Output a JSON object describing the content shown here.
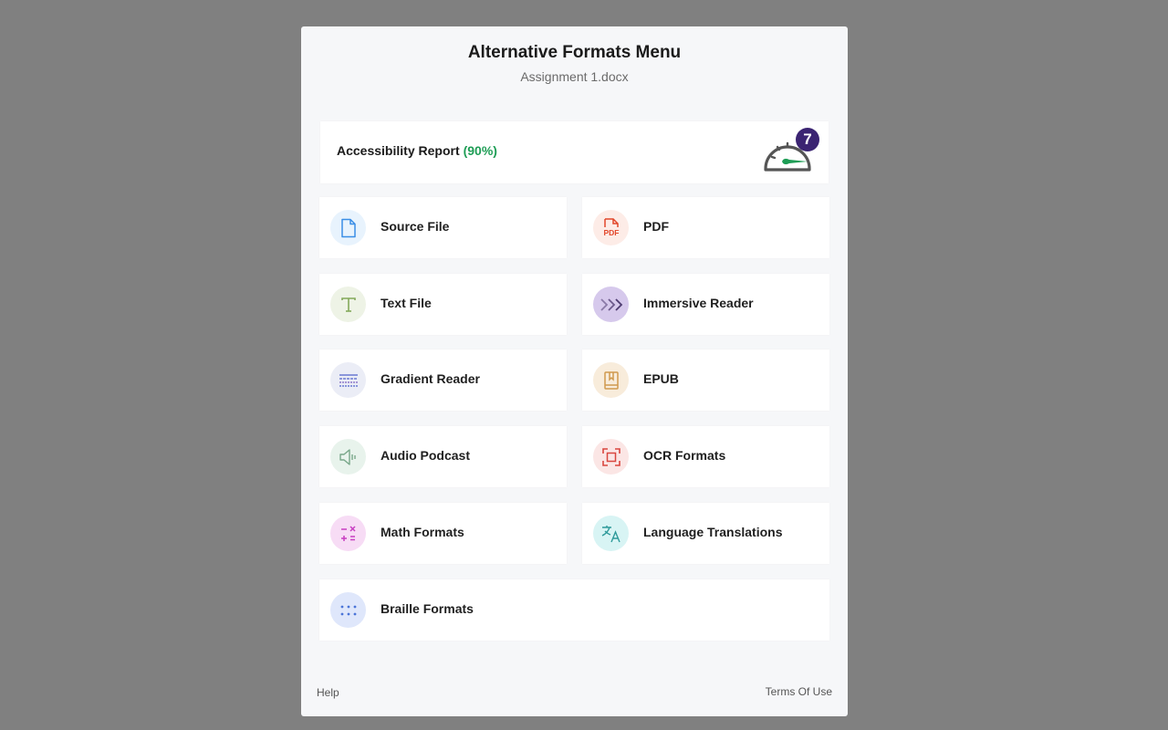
{
  "dialog": {
    "title": "Alternative Formats Menu",
    "subtitle": "Assignment 1.docx"
  },
  "report": {
    "label": "Accessibility Report",
    "percent": "(90%)",
    "badge_count": "7",
    "score_fraction": 0.9,
    "colors": {
      "percent": "#1e9d55",
      "badge": "#3b2472",
      "needle": "#1e9d55"
    }
  },
  "formats": [
    {
      "label": "Source File",
      "icon": "file-icon",
      "icon_bg": "#e8f3fd",
      "icon_color": "#3a8ee6"
    },
    {
      "label": "PDF",
      "icon": "pdf-icon",
      "icon_bg": "#fdece7",
      "icon_color": "#e2462a"
    },
    {
      "label": "Text File",
      "icon": "text-t-icon",
      "icon_bg": "#eef3e6",
      "icon_color": "#84a95a"
    },
    {
      "label": "Immersive Reader",
      "icon": "chevrons-right-icon",
      "icon_bg": "#d6c9ec",
      "icon_color": "#6c5a8c"
    },
    {
      "label": "Gradient Reader",
      "icon": "gradient-lines-icon",
      "icon_bg": "#ebedf6",
      "icon_color": "#6b7ad2"
    },
    {
      "label": "EPUB",
      "icon": "book-icon",
      "icon_bg": "#f8ecdb",
      "icon_color": "#cf9a4e"
    },
    {
      "label": "Audio Podcast",
      "icon": "speaker-icon",
      "icon_bg": "#e8f3ec",
      "icon_color": "#79a88a"
    },
    {
      "label": "OCR Formats",
      "icon": "scan-frame-icon",
      "icon_bg": "#fbe6e5",
      "icon_color": "#d9463f"
    },
    {
      "label": "Math Formats",
      "icon": "math-operators-icon",
      "icon_bg": "#f7dcf5",
      "icon_color": "#c83fc2"
    },
    {
      "label": "Language Translations",
      "icon": "translate-icon",
      "icon_bg": "#d8f4f4",
      "icon_color": "#2e9a9a"
    },
    {
      "label": "Braille Formats",
      "icon": "braille-dots-icon",
      "icon_bg": "#dfe7fb",
      "icon_color": "#4a74d8"
    }
  ],
  "footer": {
    "help": "Help",
    "terms": "Terms Of Use"
  }
}
